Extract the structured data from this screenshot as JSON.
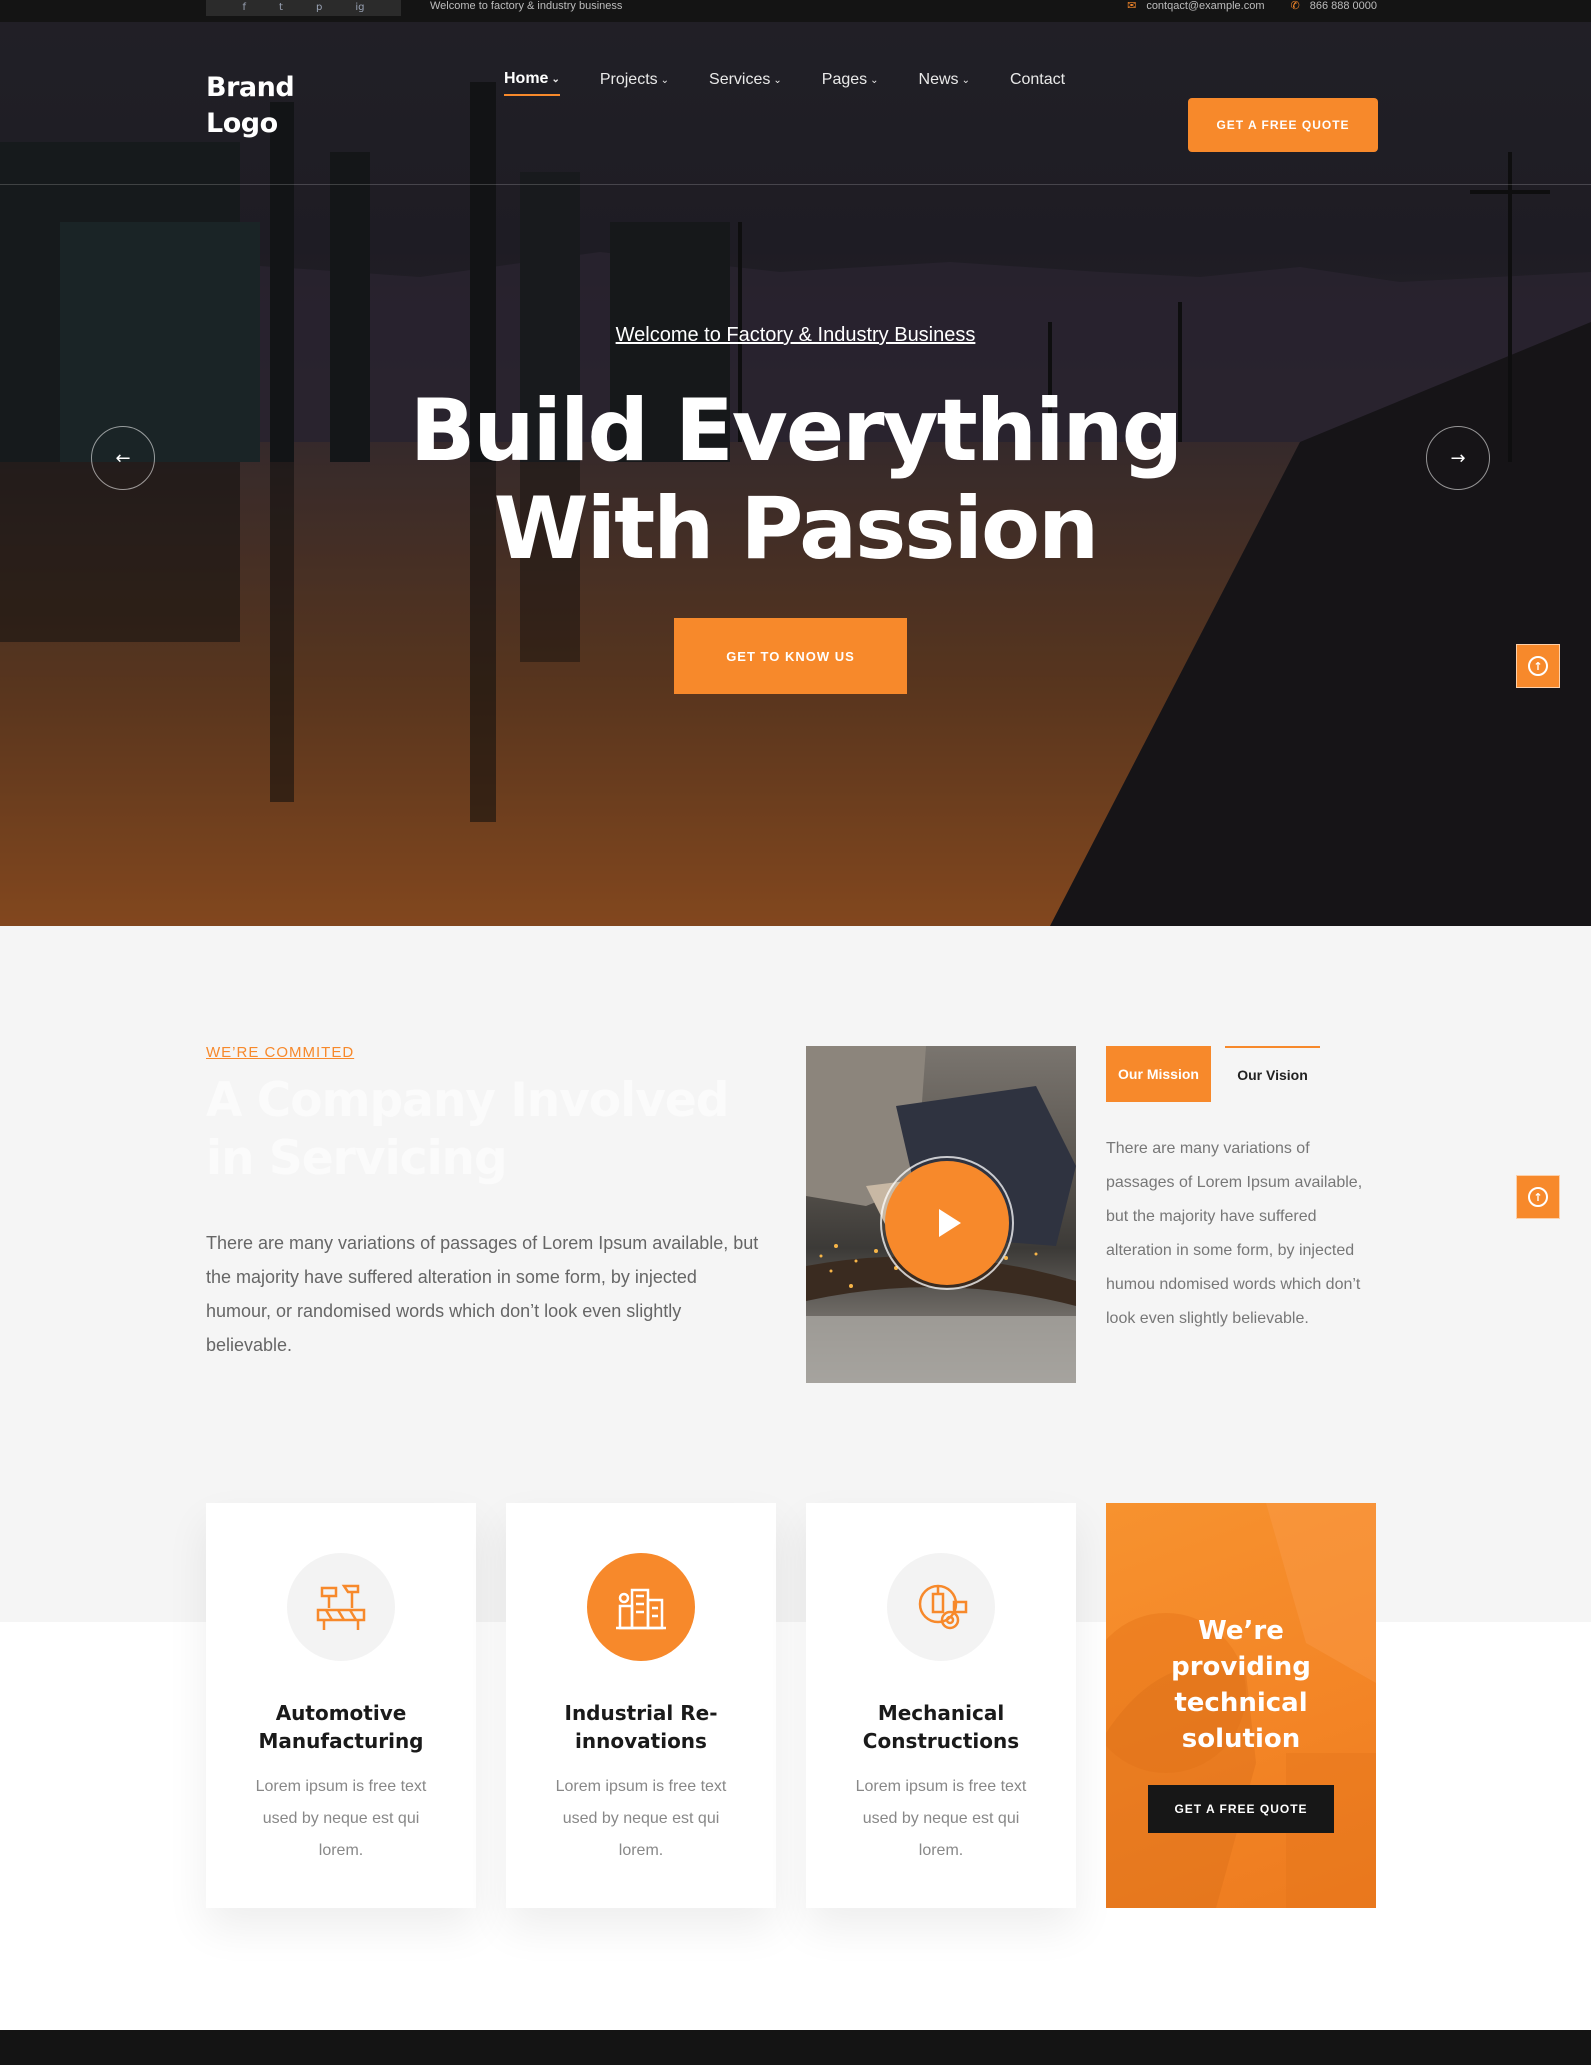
{
  "topbar": {
    "social": [
      "f",
      "t",
      "p",
      "ig"
    ],
    "welcome": "Welcome to factory & industry business",
    "email": "contqact@example.com",
    "phone": "866 888 0000"
  },
  "header": {
    "brand": "Brand Logo",
    "nav": [
      {
        "label": "Home"
      },
      {
        "label": "Projects"
      },
      {
        "label": "Services"
      },
      {
        "label": "Pages"
      },
      {
        "label": "News"
      },
      {
        "label": "Contact"
      }
    ],
    "cta": "GET A FREE QUOTE"
  },
  "hero": {
    "subtitle": "Welcome to Factory & Industry Business",
    "title_line1": "Build Everything",
    "title_line2": "With Passion",
    "button": "GET TO KNOW US",
    "prev_icon": "←",
    "next_icon": "→"
  },
  "about": {
    "eyebrow": "WE’RE COMMITED",
    "title": "A Company Involved in Servicing",
    "text": "There are many variations of passages of Lorem Ipsum available, but the majority have suffered alteration in some form, by injected humour, or randomised words which don’t look even slightly believable.",
    "tabs": [
      "Our Mission",
      "Our Vision"
    ],
    "tab_text": "There are many variations of passages of Lorem Ipsum available, but the majority have suffered alteration in some form, by injected humou ndomised words which don’t look even slightly believable."
  },
  "services": [
    {
      "title": "Automotive Manufacturing",
      "text": "Lorem ipsum is free text used by neque est qui lorem.",
      "icon": "construction-icon"
    },
    {
      "title": "Industrial Re-innovations",
      "text": "Lorem ipsum is free text used by neque est qui lorem.",
      "icon": "city-buildings-icon"
    },
    {
      "title": "Mechanical Constructions",
      "text": "Lorem ipsum is free text used by neque est qui lorem.",
      "icon": "engineering-gear-icon"
    }
  ],
  "promo": {
    "title": "We’re providing technical solution",
    "button": "GET A FREE QUOTE"
  },
  "scroll_top_icon": "↑",
  "colors": {
    "accent": "#f7892b",
    "dark": "#141414"
  }
}
